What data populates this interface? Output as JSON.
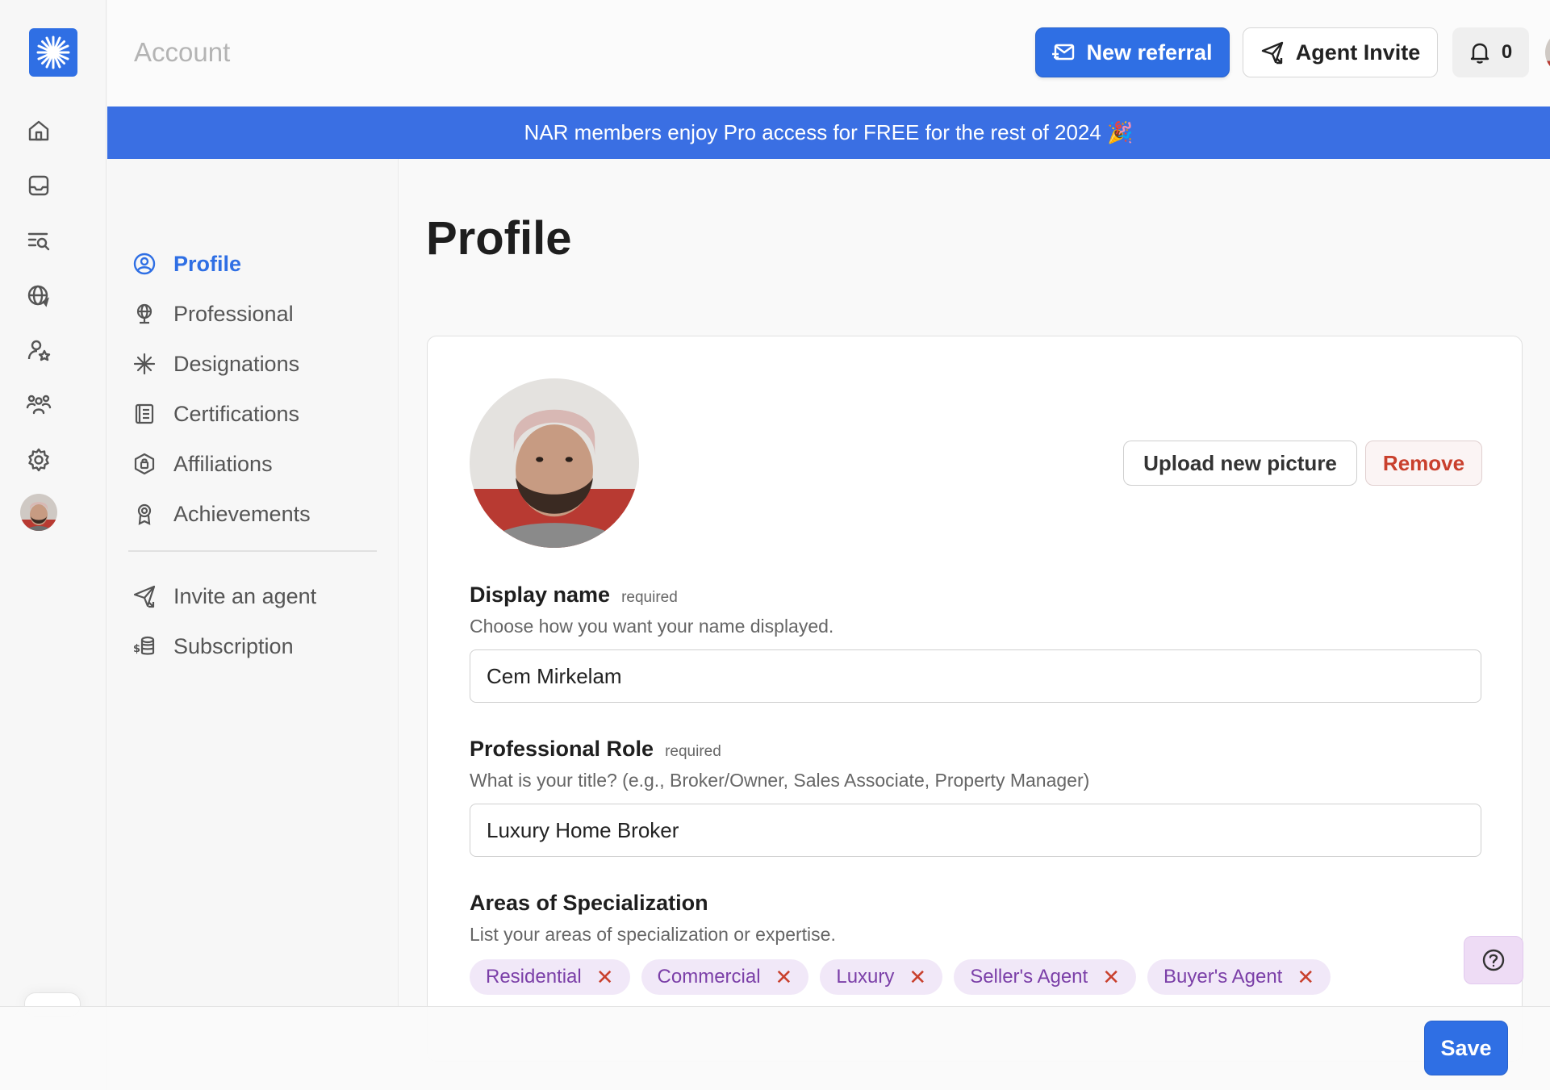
{
  "header": {
    "title": "Account",
    "new_referral_label": "New referral",
    "agent_invite_label": "Agent Invite",
    "notification_count": "0"
  },
  "banner": {
    "text": "NAR members enjoy Pro access for FREE for the rest of 2024 🎉"
  },
  "rail": {
    "items": [
      "home-icon",
      "inbox-icon",
      "search-list-icon",
      "globe-icon",
      "user-star-icon",
      "team-icon",
      "gear-icon"
    ]
  },
  "section_nav": {
    "items": [
      {
        "label": "Profile",
        "icon": "user-circle-icon",
        "active": true
      },
      {
        "label": "Professional",
        "icon": "globe-stand-icon"
      },
      {
        "label": "Designations",
        "icon": "sparkle-icon"
      },
      {
        "label": "Certifications",
        "icon": "document-icon"
      },
      {
        "label": "Affiliations",
        "icon": "badge-icon"
      },
      {
        "label": "Achievements",
        "icon": "award-icon"
      }
    ],
    "secondary": [
      {
        "label": "Invite an agent",
        "icon": "send-icon"
      },
      {
        "label": "Subscription",
        "icon": "coins-icon"
      }
    ]
  },
  "main": {
    "title": "Profile",
    "upload_label": "Upload new picture",
    "remove_label": "Remove",
    "display_name": {
      "label": "Display name",
      "required": "required",
      "help": "Choose how you want your name displayed.",
      "value": "Cem Mirkelam"
    },
    "professional_role": {
      "label": "Professional Role",
      "required": "required",
      "help": "What is your title? (e.g., Broker/Owner, Sales Associate, Property Manager)",
      "value": "Luxury Home Broker"
    },
    "specialization": {
      "label": "Areas of Specialization",
      "help": "List your areas of specialization or expertise.",
      "tags": [
        "Residential",
        "Commercial",
        "Luxury",
        "Seller's Agent",
        "Buyer's Agent"
      ]
    }
  },
  "footer": {
    "save_label": "Save"
  },
  "colors": {
    "accent": "#2f6fe4",
    "danger": "#c9402d",
    "chip_bg": "#f1e8f8",
    "chip_text": "#7b3fa8"
  }
}
